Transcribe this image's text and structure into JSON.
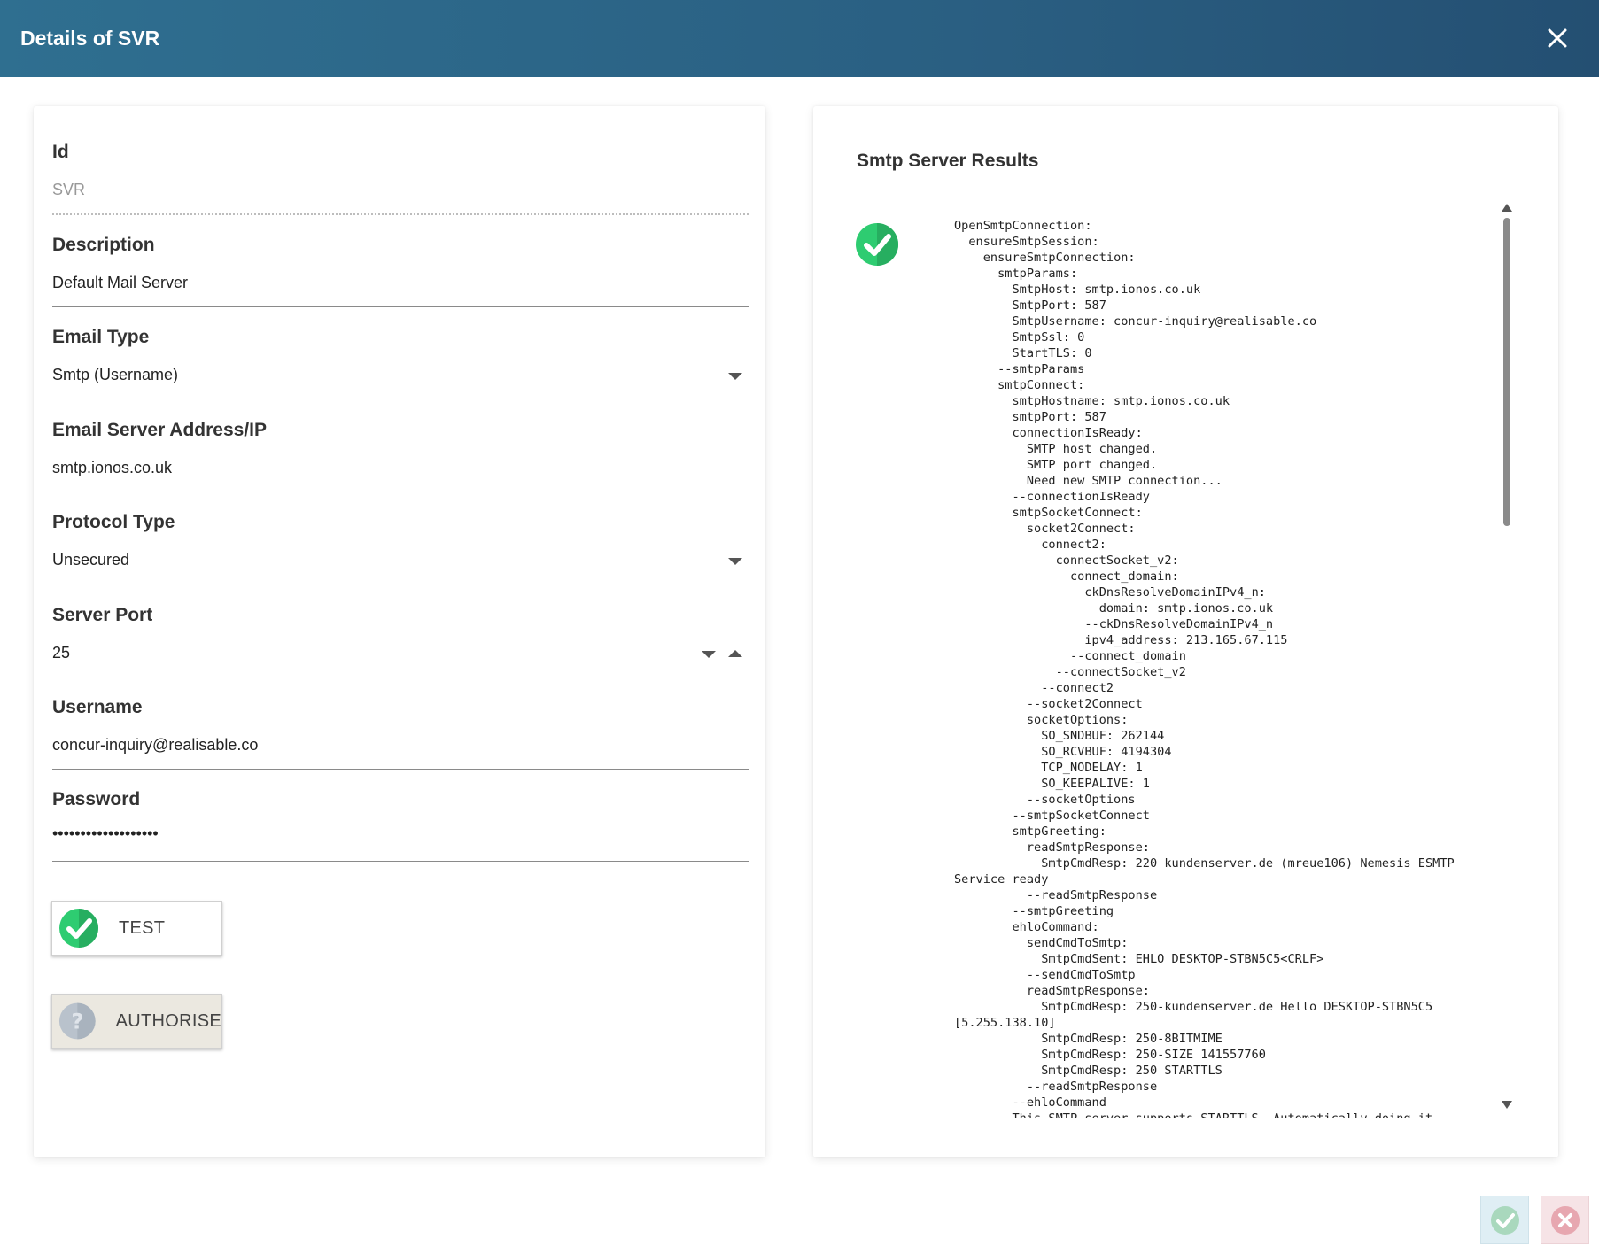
{
  "window": {
    "title": "Details of SVR"
  },
  "form": {
    "id": {
      "label": "Id",
      "value": "SVR"
    },
    "description": {
      "label": "Description",
      "value": "Default Mail Server"
    },
    "email_type": {
      "label": "Email Type",
      "value": "Smtp (Username)"
    },
    "server_address": {
      "label": "Email Server Address/IP",
      "value": "smtp.ionos.co.uk"
    },
    "protocol_type": {
      "label": "Protocol Type",
      "value": "Unsecured"
    },
    "server_port": {
      "label": "Server Port",
      "value": "25"
    },
    "username": {
      "label": "Username",
      "value": "concur-inquiry@realisable.co"
    },
    "password": {
      "label": "Password",
      "value": "•••••••••••••••••••"
    },
    "test_button": {
      "label": "TEST"
    },
    "authorise_button": {
      "label": "AUTHORISE"
    }
  },
  "results": {
    "title": "Smtp Server Results",
    "log": "OpenSmtpConnection:\n  ensureSmtpSession:\n    ensureSmtpConnection:\n      smtpParams:\n        SmtpHost: smtp.ionos.co.uk\n        SmtpPort: 587\n        SmtpUsername: concur-inquiry@realisable.co\n        SmtpSsl: 0\n        StartTLS: 0\n      --smtpParams\n      smtpConnect:\n        smtpHostname: smtp.ionos.co.uk\n        smtpPort: 587\n        connectionIsReady:\n          SMTP host changed.\n          SMTP port changed.\n          Need new SMTP connection...\n        --connectionIsReady\n        smtpSocketConnect:\n          socket2Connect:\n            connect2:\n              connectSocket_v2:\n                connect_domain:\n                  ckDnsResolveDomainIPv4_n:\n                    domain: smtp.ionos.co.uk\n                  --ckDnsResolveDomainIPv4_n\n                  ipv4_address: 213.165.67.115\n                --connect_domain\n              --connectSocket_v2\n            --connect2\n          --socket2Connect\n          socketOptions:\n            SO_SNDBUF: 262144\n            SO_RCVBUF: 4194304\n            TCP_NODELAY: 1\n            SO_KEEPALIVE: 1\n          --socketOptions\n        --smtpSocketConnect\n        smtpGreeting:\n          readSmtpResponse:\n            SmtpCmdResp: 220 kundenserver.de (mreue106) Nemesis ESMTP Service ready\n          --readSmtpResponse\n        --smtpGreeting\n        ehloCommand:\n          sendCmdToSmtp:\n            SmtpCmdSent: EHLO DESKTOP-STBN5C5<CRLF>\n          --sendCmdToSmtp\n          readSmtpResponse:\n            SmtpCmdResp: 250-kundenserver.de Hello DESKTOP-STBN5C5 [5.255.138.10]\n            SmtpCmdResp: 250-8BITMIME\n            SmtpCmdResp: 250-SIZE 141557760\n            SmtpCmdResp: 250 STARTTLS\n          --readSmtpResponse\n        --ehloCommand\n        This SMTP server supports STARTTLS. Automatically doing it."
  },
  "colors": {
    "header": "#2a5f82",
    "success": "#2ecc71",
    "active_underline": "#3aa655"
  }
}
